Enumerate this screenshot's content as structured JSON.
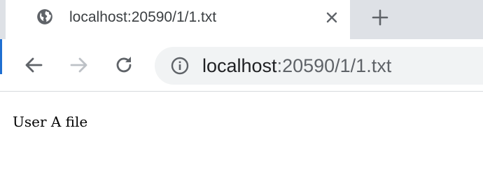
{
  "tab": {
    "title": "localhost:20590/1/1.txt",
    "favicon_icon": "globe-icon",
    "close_icon": "close-icon"
  },
  "new_tab_icon": "plus-icon",
  "toolbar": {
    "back_icon": "arrow-left-icon",
    "forward_icon": "arrow-right-icon",
    "reload_icon": "reload-icon"
  },
  "omnibox": {
    "info_icon": "info-icon",
    "url_host": "localhost",
    "url_rest": ":20590/1/1.txt"
  },
  "page": {
    "content_text": "User A file"
  },
  "colors": {
    "tabstrip": "#dee1e6",
    "omnibox_bg": "#f1f3f4",
    "icon": "#5f6368",
    "disabled_icon": "#bdc1c6"
  }
}
